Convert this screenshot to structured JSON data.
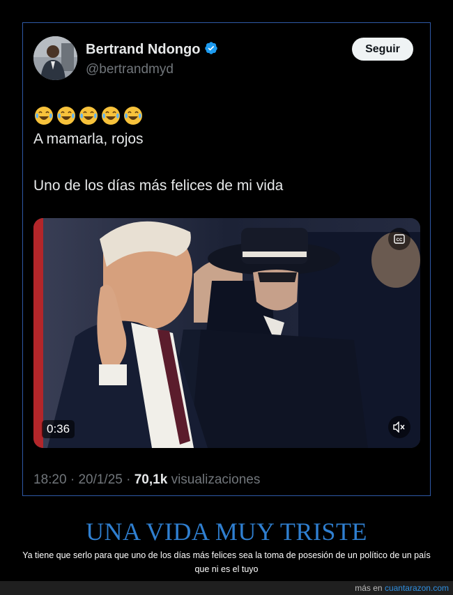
{
  "tweet": {
    "author_name": "Bertrand Ndongo",
    "handle": "@bertrandmyd",
    "follow_label": "Seguir",
    "emojis": [
      "face-with-tears-of-joy",
      "face-with-tears-of-joy",
      "face-with-tears-of-joy",
      "face-with-tears-of-joy",
      "face-with-tears-of-joy"
    ],
    "line1": "A mamarla, rojos",
    "line2": "Uno de los días más felices de mi vida",
    "video": {
      "duration": "0:36"
    },
    "time": "18:20",
    "date": "20/1/25",
    "views_count": "70,1k",
    "views_label": "visualizaciones",
    "separator": "·"
  },
  "post": {
    "headline": "UNA VIDA MUY TRISTE",
    "caption": "Ya tiene que serlo para que uno de los días más felices sea la toma de posesión de un político de un país que ni es el tuyo"
  },
  "footer": {
    "prefix": "más en",
    "site": "cuantarazon.com"
  },
  "colors": {
    "background": "#000000",
    "card_border": "#2f5aa8",
    "verified_blue": "#1d9bf0",
    "headline_blue": "#2f7fd0",
    "muted_text": "#71767b",
    "link_blue": "#2f8fe0"
  }
}
